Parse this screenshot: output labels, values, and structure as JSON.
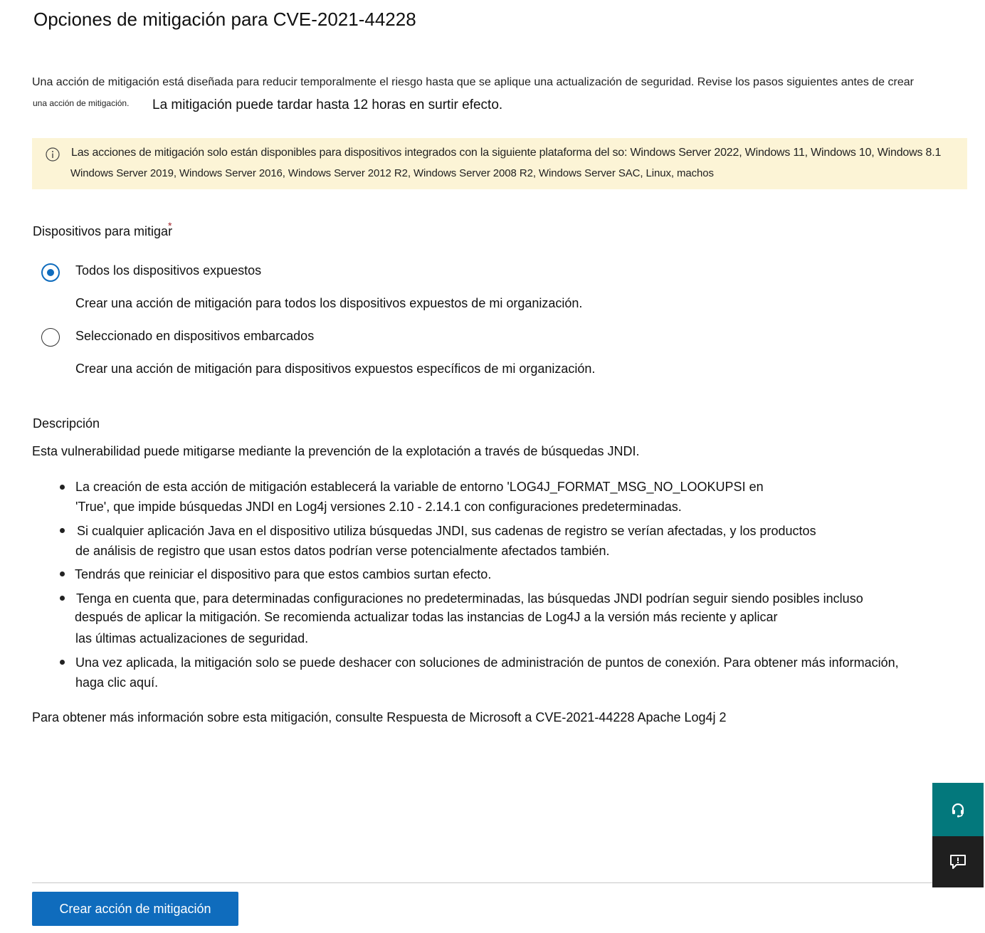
{
  "page": {
    "title": "Opciones de mitigación para CVE-2021-44228",
    "intro_line1": "Una acción de mitigación está diseñada para reducir temporalmente el riesgo hasta que se aplique una actualización de seguridad. Revise los pasos siguientes antes de crear",
    "intro_line2a": "una acción de mitigación.",
    "intro_line2b": "La mitigación puede tardar hasta 12 horas en surtir efecto."
  },
  "banner": {
    "icon": "info-icon",
    "line1": "Las acciones de mitigación solo están disponibles para dispositivos integrados con la siguiente plataforma del so: Windows Server 2022, Windows 11, Windows 10, Windows 8.1",
    "line2": "Windows Server 2019, Windows Server 2016, Windows Server 2012 R2, Windows Server 2008 R2, Windows Server SAC, Linux, machos",
    "background": "#fcf4d6"
  },
  "devices": {
    "label": "Dispositivos para mitigar",
    "required_mark": "*",
    "options": [
      {
        "label": "Todos los dispositivos expuestos",
        "description": "Crear una acción de mitigación para todos los dispositivos expuestos de mi organización.",
        "selected": true
      },
      {
        "label": "Seleccionado en dispositivos embarcados",
        "description": "Crear una acción de mitigación para dispositivos expuestos específicos de mi organización.",
        "selected": false
      }
    ]
  },
  "description": {
    "heading": "Descripción",
    "intro": "Esta vulnerabilidad puede mitigarse mediante la prevención de la explotación a través de búsquedas JNDI.",
    "bullets": [
      {
        "lines": [
          "La creación de esta acción de mitigación establecerá la variable de entorno 'LOG4J_FORMAT_MSG_NO_LOOKUPSI en",
          "'True', que impide búsquedas JNDI en Log4j versiones 2.10 - 2.14.1 con configuraciones predeterminadas."
        ]
      },
      {
        "lines": [
          "Si cualquier aplicación Java en el dispositivo utiliza búsquedas JNDI, sus cadenas de registro se verían afectadas, y los productos",
          "de análisis de registro que usan estos datos podrían verse potencialmente afectados también."
        ]
      },
      {
        "lines": [
          "Tendrás que reiniciar el dispositivo para que estos cambios surtan efecto."
        ]
      },
      {
        "lines": [
          "Tenga en cuenta que, para determinadas configuraciones no predeterminadas, las búsquedas JNDI podrían seguir siendo posibles incluso",
          "después de aplicar la mitigación. Se recomienda actualizar todas las instancias de Log4J a la versión más reciente y aplicar",
          "las últimas actualizaciones de seguridad."
        ]
      },
      {
        "lines": [
          "Una vez aplicada, la mitigación solo se puede deshacer con soluciones de administración de puntos de conexión. Para obtener más información,",
          "haga clic aquí."
        ]
      }
    ],
    "more_info": "Para obtener más información sobre esta mitigación, consulte Respuesta de Microsoft a CVE-2021-44228 Apache Log4j 2"
  },
  "footer": {
    "primary_button": "Crear acción de mitigación",
    "primary_color": "#0f6cbd"
  },
  "side_panel": {
    "help_icon": "headset-icon",
    "help_color": "#03787c",
    "feedback_icon": "feedback-icon",
    "feedback_color": "#1f1f1f"
  }
}
